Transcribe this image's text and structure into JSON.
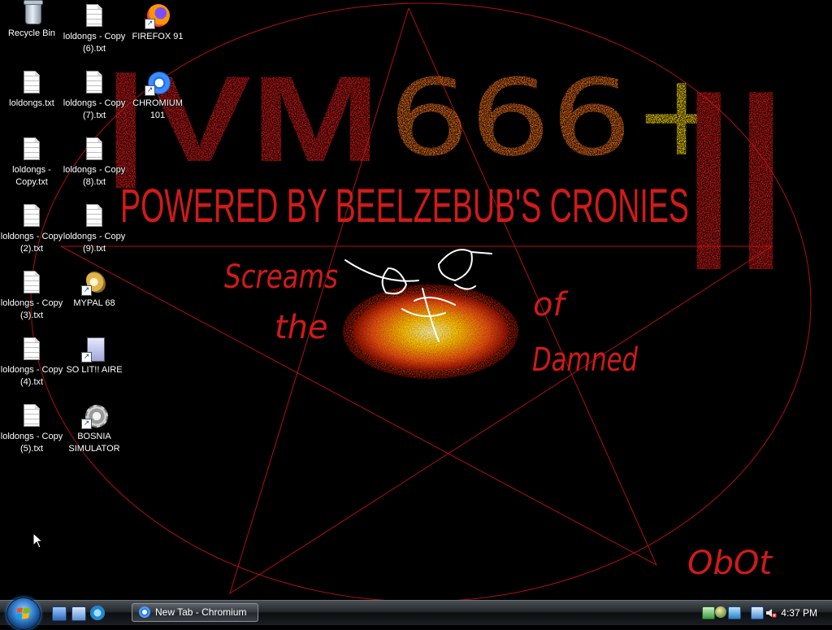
{
  "wallpaper": {
    "logo_text": "VM6664",
    "powered_text": "POWERED BY BEELZEBUB'S CRONIES",
    "scream_words": [
      "Screams",
      "the",
      "of",
      "Damned"
    ],
    "signature": "ObOt",
    "colors": {
      "red": "#d11a1a",
      "line": "#b01010",
      "orange": "#e07020",
      "yellow": "#f0d000"
    }
  },
  "desktop_icons": [
    {
      "label": "Recycle Bin",
      "icon": "recycle-bin-icon"
    },
    {
      "label": "loldongs.txt",
      "icon": "text-file-icon"
    },
    {
      "label": "loldongs - Copy.txt",
      "icon": "text-file-icon"
    },
    {
      "label": "loldongs - Copy (2).txt",
      "icon": "text-file-icon"
    },
    {
      "label": "loldongs - Copy (3).txt",
      "icon": "text-file-icon"
    },
    {
      "label": "loldongs - Copy (4).txt",
      "icon": "text-file-icon"
    },
    {
      "label": "loldongs - Copy (5).txt",
      "icon": "text-file-icon"
    },
    {
      "label": "loldongs - Copy (6).txt",
      "icon": "text-file-icon"
    },
    {
      "label": "loldongs - Copy (7).txt",
      "icon": "text-file-icon"
    },
    {
      "label": "loldongs - Copy (8).txt",
      "icon": "text-file-icon"
    },
    {
      "label": "loldongs - Copy (9).txt",
      "icon": "text-file-icon"
    },
    {
      "label": "MYPAL 68",
      "icon": "mypal-shortcut-icon"
    },
    {
      "label": "SO LIT!! AIRE",
      "icon": "aire-shortcut-icon"
    },
    {
      "label": "BOSNIA SIMULATOR",
      "icon": "bosnia-shortcut-icon"
    },
    {
      "label": "FIREFOX 91",
      "icon": "firefox-shortcut-icon"
    },
    {
      "label": "CHROMIUM 101",
      "icon": "chromium-shortcut-icon"
    }
  ],
  "taskbar": {
    "start_icon": "windows-start-icon",
    "quick_launch": [
      "show-desktop-icon",
      "switch-windows-icon",
      "internet-explorer-icon"
    ],
    "tasks": [
      {
        "label": "New Tab - Chromium",
        "icon": "chromium-icon"
      }
    ],
    "tray_icons": [
      "network-icon",
      "users-icon",
      "safely-remove-icon",
      "network-status-icon",
      "volume-muted-icon"
    ],
    "clock": "4:37 PM"
  }
}
